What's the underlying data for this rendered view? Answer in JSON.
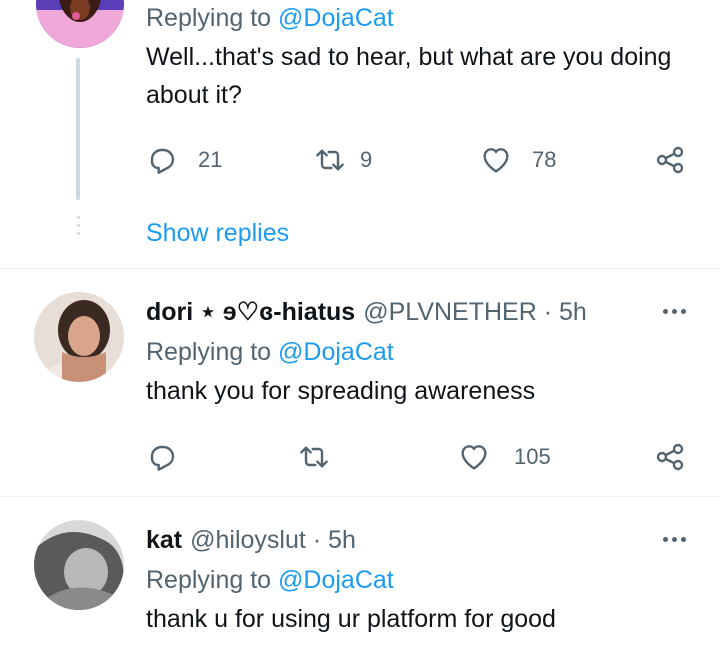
{
  "tweets": [
    {
      "reply_label": "Replying to",
      "reply_to": "@DojaCat",
      "text": "Well...that's sad to hear, but what are you doing about it?",
      "replies": "21",
      "retweets": "9",
      "likes": "78",
      "show_replies": "Show replies"
    },
    {
      "name": "dori ⋆ ɘ♡ɞ-hiatus",
      "handle": "@PLVNETHER · 5h",
      "reply_label": "Replying to",
      "reply_to": "@DojaCat",
      "text": "thank you for spreading awareness",
      "replies": "",
      "retweets": "",
      "likes": "105"
    },
    {
      "name": "kat",
      "handle": "@hiloyslut · 5h",
      "reply_label": "Replying to",
      "reply_to": "@DojaCat",
      "text": "thank u for using ur platform for good"
    }
  ],
  "icons": {
    "reply": "reply-icon",
    "retweet": "retweet-icon",
    "like": "heart-icon",
    "share": "share-icon",
    "more": "more-icon"
  },
  "colors": {
    "accent": "#1d9bf0",
    "secondary_text": "#536471",
    "primary_text": "#0f1419",
    "divider": "#eff3f4"
  }
}
